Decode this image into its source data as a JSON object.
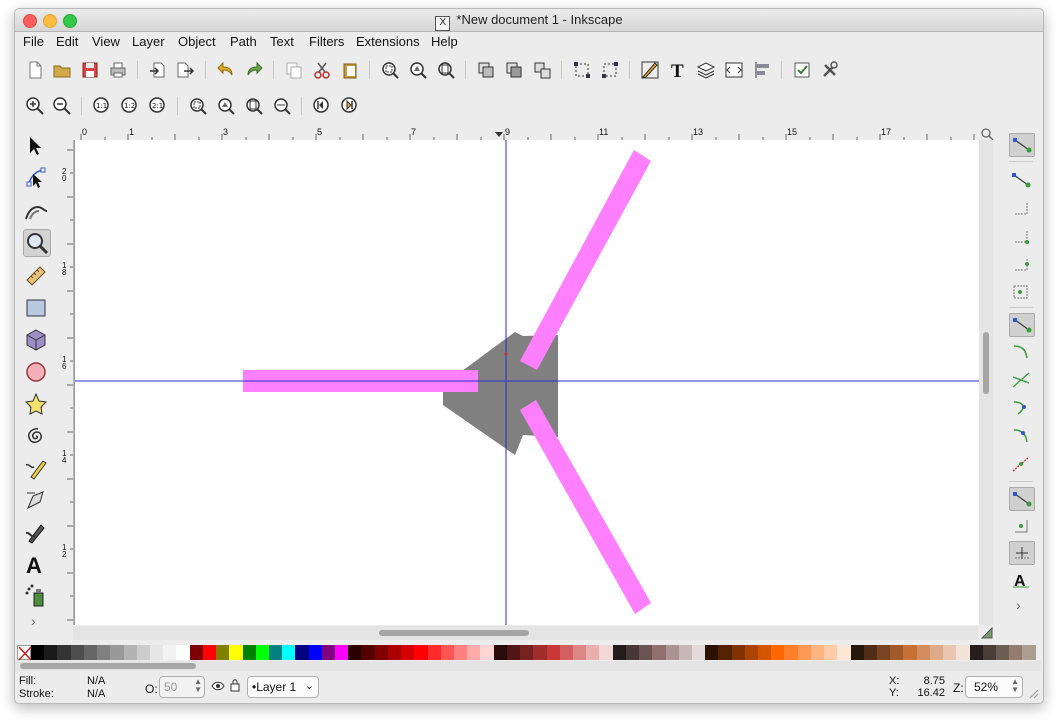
{
  "window": {
    "title": "*New document 1 - Inkscape",
    "title_icon": "X"
  },
  "menu": [
    "File",
    "Edit",
    "View",
    "Layer",
    "Object",
    "Path",
    "Text",
    "Filters",
    "Extensions",
    "Help"
  ],
  "toolbar1": {
    "icons": [
      "new-document-icon",
      "open-icon",
      "save-icon",
      "print-icon",
      "import-icon",
      "export-icon",
      "undo-icon",
      "redo-icon",
      "duplicate-icon",
      "cut-icon",
      "paste-icon",
      "zoom-selection-icon",
      "zoom-drawing-icon",
      "zoom-page-icon",
      "group-icon",
      "lock-group-icon",
      "ungroup-icon",
      "align-node-icon",
      "align-object-icon",
      "xml-editor-icon",
      "text-icon",
      "layers-icon",
      "fill-stroke-icon",
      "align-distribute-icon",
      "preferences-icon",
      "document-properties-icon"
    ]
  },
  "toolbar2": {
    "icons": [
      "zoom-in-icon",
      "zoom-out-icon",
      "zoom-1-1-icon",
      "zoom-1-2-icon",
      "zoom-2-1-icon",
      "zoom-selection-icon",
      "zoom-drawing-icon",
      "zoom-page-icon",
      "zoom-page-width-icon",
      "zoom-previous-icon",
      "zoom-next-icon"
    ]
  },
  "tools": {
    "icons": [
      "selector-icon",
      "node-icon",
      "tweak-icon",
      "zoom-icon",
      "measure-icon",
      "rectangle-icon",
      "3d-box-icon",
      "ellipse-icon",
      "star-icon",
      "spiral-icon",
      "pencil-icon",
      "pen-icon",
      "calligraphy-icon",
      "text-tool-icon",
      "spray-icon"
    ],
    "active": "zoom-icon",
    "more": "›"
  },
  "snap": {
    "icons": [
      "snap-enable-icon",
      "snap-bbox-icon",
      "snap-bbox-edge-icon",
      "snap-bbox-corner-icon",
      "snap-bbox-edge-mid-icon",
      "snap-bbox-center-icon",
      "snap-nodes-icon",
      "snap-path-icon",
      "snap-intersection-icon",
      "snap-smooth-icon",
      "snap-midpoint-icon",
      "snap-center-icon",
      "snap-rotation-center-icon",
      "snap-page-icon",
      "snap-grid-icon",
      "snap-text-baseline-icon"
    ],
    "more": "›"
  },
  "ruler_h": [
    "0",
    "1",
    "3",
    "5",
    "7",
    "9",
    "11",
    "13",
    "15",
    "17"
  ],
  "ruler_v": [
    "2\n0",
    "1\n8",
    "1\n6",
    "1\n4",
    "1\n2"
  ],
  "canvas": {
    "fill_color": "#ff80ff",
    "shape_color": "#808080",
    "guide_color": "#2b2bcc"
  },
  "palette": [
    "#000000",
    "#1a1a1a",
    "#333333",
    "#4d4d4d",
    "#666666",
    "#808080",
    "#999999",
    "#b3b3b3",
    "#cccccc",
    "#e6e6e6",
    "#f2f2f2",
    "#ffffff",
    "#800000",
    "#ff0000",
    "#808000",
    "#ffff00",
    "#008000",
    "#00ff00",
    "#008080",
    "#00ffff",
    "#000080",
    "#0000ff",
    "#800080",
    "#ff00ff",
    "#2b0000",
    "#550000",
    "#800000",
    "#aa0000",
    "#d40000",
    "#ff0000",
    "#ff2a2a",
    "#ff5555",
    "#ff8080",
    "#ffaaaa",
    "#ffd5d5",
    "#280b0b",
    "#501616",
    "#782121",
    "#a02c2c",
    "#c83737",
    "#d35f5f",
    "#de8787",
    "#e9afaf",
    "#f4d7d7",
    "#241c1c",
    "#483737",
    "#6c5353",
    "#916f6f",
    "#ac9393",
    "#c8b7b7",
    "#e3dbdb",
    "#2b1100",
    "#552200",
    "#803300",
    "#aa4400",
    "#d45500",
    "#ff6600",
    "#ff7f2a",
    "#ff9955",
    "#ffb380",
    "#ffccaa",
    "#ffe6d5",
    "#28170b",
    "#502d16",
    "#784421",
    "#a05a2c",
    "#c87137",
    "#d38d5f",
    "#deaa87",
    "#e9c6af",
    "#f4e3d7",
    "#241f1c",
    "#483e37",
    "#6c5d53",
    "#917c6f",
    "#ac9d93"
  ],
  "status": {
    "fill_label": "Fill:",
    "fill_value": "N/A",
    "stroke_label": "Stroke:",
    "stroke_value": "N/A",
    "opacity_label": "O:",
    "opacity_value": "50",
    "layer": "•Layer 1",
    "x_label": "X:",
    "x_value": "8.75",
    "y_label": "Y:",
    "y_value": "16.42",
    "z_label": "Z:",
    "zoom": "52%"
  }
}
